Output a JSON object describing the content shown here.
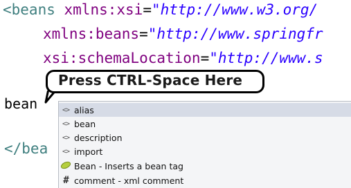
{
  "code": {
    "line1": {
      "tag": "<beans",
      "attr": "xmlns:xsi",
      "eq": "=",
      "value": "\"http://www.w3.org/"
    },
    "line2": {
      "attr": "xmlns:beans",
      "eq": "=",
      "value": "\"http://www.springfr"
    },
    "line3": {
      "attr": "xsi:schemaLocation",
      "eq": "=",
      "value": "\"http://www.s"
    },
    "line4": {
      "text": "bean"
    },
    "line5": {
      "tag": "</bea"
    }
  },
  "callout": {
    "text": "Press CTRL-Space Here"
  },
  "popup": {
    "items": [
      {
        "icon": "xml-element-icon",
        "glyph": "<>",
        "label": "alias",
        "selected": true
      },
      {
        "icon": "xml-element-icon",
        "glyph": "<>",
        "label": "bean"
      },
      {
        "icon": "xml-element-icon",
        "glyph": "<>",
        "label": "description"
      },
      {
        "icon": "xml-element-icon",
        "glyph": "<>",
        "label": "import"
      },
      {
        "icon": "template-leaf-icon",
        "glyph": "",
        "label": "Bean - Inserts a bean tag"
      },
      {
        "icon": "comment-hash-icon",
        "glyph": "#",
        "label": "comment - xml comment"
      }
    ]
  },
  "colors": {
    "tag": "#3f7f7f",
    "attribute": "#7f007f",
    "string": "#2a00ff",
    "selection": "#d6dbe6"
  }
}
